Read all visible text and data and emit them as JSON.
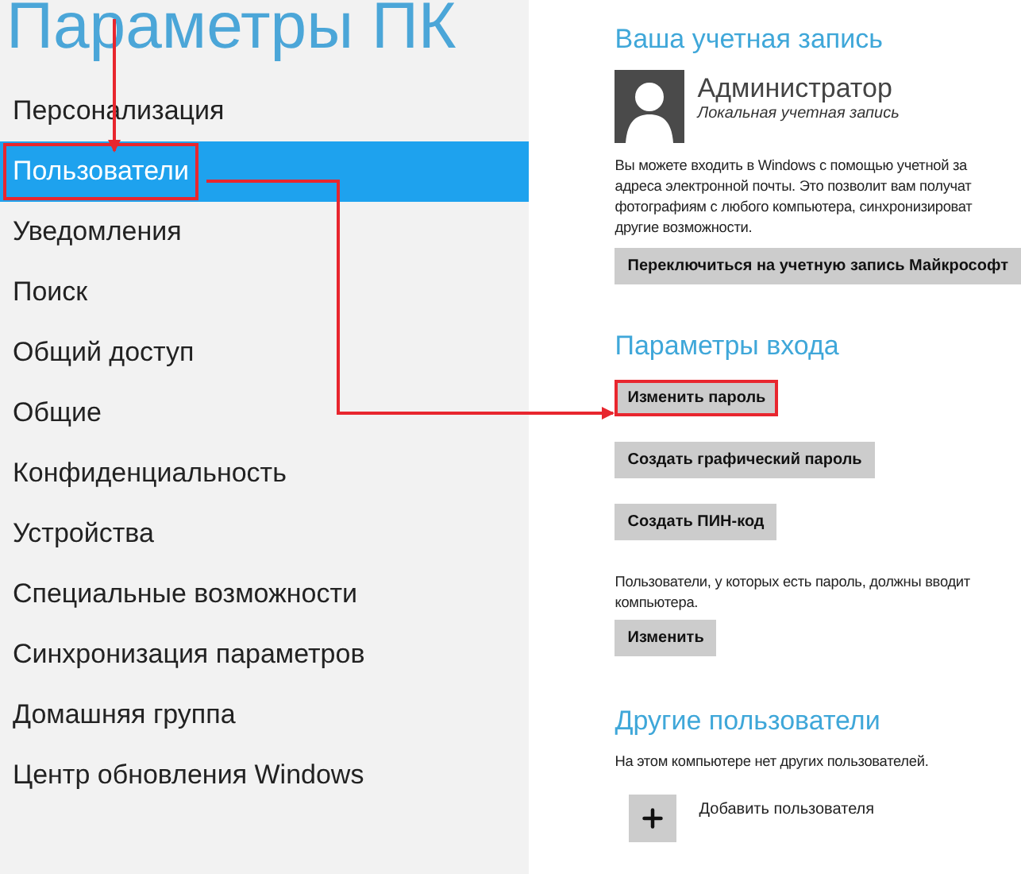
{
  "title": "Параметры ПК",
  "sidebar": {
    "items": [
      {
        "label": "Персонализация",
        "selected": false,
        "annotated": false
      },
      {
        "label": "Пользователи",
        "selected": true,
        "annotated": true
      },
      {
        "label": "Уведомления",
        "selected": false,
        "annotated": false
      },
      {
        "label": "Поиск",
        "selected": false,
        "annotated": false
      },
      {
        "label": "Общий доступ",
        "selected": false,
        "annotated": false
      },
      {
        "label": "Общие",
        "selected": false,
        "annotated": false
      },
      {
        "label": "Конфиденциальность",
        "selected": false,
        "annotated": false
      },
      {
        "label": "Устройства",
        "selected": false,
        "annotated": false
      },
      {
        "label": "Специальные возможности",
        "selected": false,
        "annotated": false
      },
      {
        "label": "Синхронизация параметров",
        "selected": false,
        "annotated": false
      },
      {
        "label": "Домашняя группа",
        "selected": false,
        "annotated": false
      },
      {
        "label": "Центр обновления Windows",
        "selected": false,
        "annotated": false
      }
    ]
  },
  "account": {
    "heading": "Ваша учетная запись",
    "name": "Администратор",
    "type": "Локальная учетная запись",
    "description": [
      "Вы можете входить в Windows с помощью учетной за",
      "адреса электронной почты. Это позволит вам получат",
      "фотографиям с любого компьютера, синхронизироват",
      "другие возможности."
    ],
    "switch_button": "Переключиться на учетную запись Майкрософт"
  },
  "sign_in": {
    "heading": "Параметры входа",
    "buttons": [
      {
        "label": "Изменить пароль",
        "annotated": true
      },
      {
        "label": "Создать графический пароль",
        "annotated": false
      },
      {
        "label": "Создать ПИН-код",
        "annotated": false
      }
    ],
    "note": [
      "Пользователи, у которых есть пароль, должны вводит",
      "компьютера."
    ],
    "change_button": "Изменить"
  },
  "other_users": {
    "heading": "Другие пользователи",
    "note": "На этом компьютере нет других пользователей.",
    "add_label": "Добавить пользователя"
  }
}
